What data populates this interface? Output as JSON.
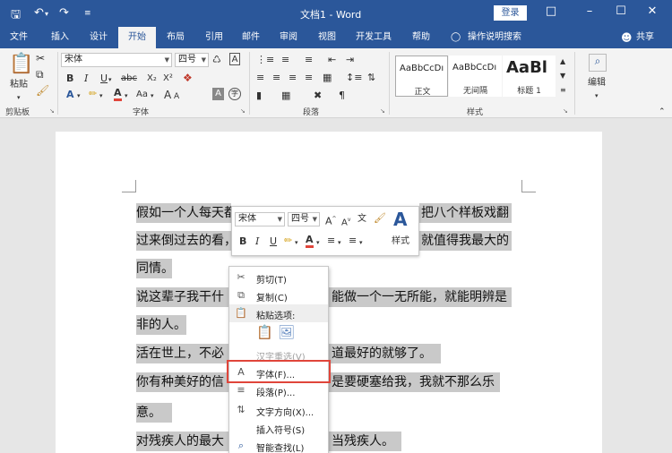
{
  "titlebar": {
    "title": "文档1 - Word",
    "login": "登录",
    "save_icon": "save-icon",
    "undo_icon": "undo-icon",
    "redo_icon": "redo-icon",
    "customize_icon": "customize-quick-access-icon"
  },
  "tabs": [
    {
      "label": "文件"
    },
    {
      "label": "插入"
    },
    {
      "label": "设计"
    },
    {
      "label": "开始",
      "active": true
    },
    {
      "label": "布局"
    },
    {
      "label": "引用"
    },
    {
      "label": "邮件"
    },
    {
      "label": "审阅"
    },
    {
      "label": "视图"
    },
    {
      "label": "开发工具"
    },
    {
      "label": "帮助"
    }
  ],
  "tell_me": "操作说明搜索",
  "share": "共享",
  "ribbon": {
    "clipboard": {
      "paste": "粘贴",
      "label": "剪贴板"
    },
    "font": {
      "name": "宋体",
      "size": "四号",
      "label": "字体",
      "bold": "B",
      "italic": "I",
      "underline": "U",
      "strike": "abc",
      "sub": "X₂",
      "sup": "X²",
      "grow": "A",
      "shrink": "A",
      "aa": "Aa",
      "clear": "A",
      "charbox": "A",
      "enclose": "字"
    },
    "paragraph": {
      "label": "段落"
    },
    "styles": {
      "label": "样式",
      "items": [
        {
          "preview": "AaBbCcDı",
          "name": "正文"
        },
        {
          "preview": "AaBbCcDı",
          "name": "无间隔"
        },
        {
          "preview": "AaBl",
          "name": "标题 1"
        }
      ]
    },
    "editing": {
      "label": "编辑"
    }
  },
  "document": {
    "lines": [
      "假如一个人每天都",
      "过来倒过去的看，",
      "同情。",
      "说这辈子我干什",
      "非的人。",
      "活在世上，不必",
      "你有种美好的信",
      "意。",
      "对残疾人的最大"
    ],
    "right_lines": [
      "把八个样板戏翻",
      "就值得我最大的",
      "能做一个一无所能，就能明辨是",
      "道最好的就够了。",
      "是要硬塞给我，我就不那么乐",
      "当残疾人。"
    ]
  },
  "minibar": {
    "font": "宋体",
    "size": "四号",
    "styles": "样式"
  },
  "context_menu": {
    "items": [
      {
        "label": "剪切(T)",
        "icon": "scissors-icon"
      },
      {
        "label": "复制(C)",
        "icon": "copy-icon"
      },
      {
        "label": "粘贴选项:",
        "icon": "paste-icon"
      },
      {
        "label": "",
        "icon": ""
      },
      {
        "label": "汉字重选(V)",
        "icon": ""
      },
      {
        "label": "字体(F)...",
        "icon": "font-icon"
      },
      {
        "label": "段落(P)...",
        "icon": "paragraph-icon"
      },
      {
        "label": "文字方向(X)...",
        "icon": "text-direction-icon"
      },
      {
        "label": "插入符号(S)",
        "icon": "symbol-icon"
      },
      {
        "label": "智能查找(L)",
        "icon": "smart-lookup-icon"
      }
    ]
  },
  "colors": {
    "word_blue": "#2b579a",
    "highlight_red": "#e0453a",
    "selection_gray": "#c9c9c9"
  }
}
